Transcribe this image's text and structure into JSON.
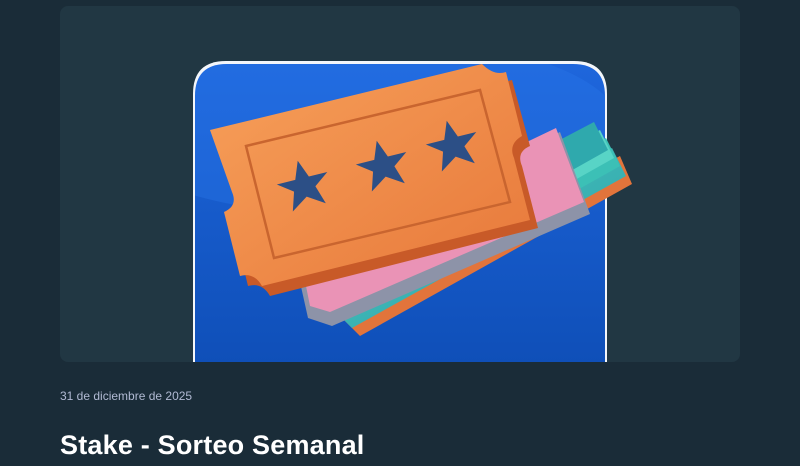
{
  "post": {
    "date": "31 de diciembre de 2025",
    "title": "Stake - Sorteo Semanal"
  },
  "hero": {
    "icon": "raffle-tickets-icon",
    "ticket_stars": 3
  },
  "colors": {
    "page_background": "#1a2c38",
    "card_background": "#213743",
    "title_text": "#ffffff",
    "date_text": "#b1bad3",
    "app_icon_blue": "#1f6fe0",
    "ticket_orange": "#f28a45",
    "ticket_teal": "#3bb7b2",
    "ticket_pink": "#e98fb3",
    "star_blue": "#2c4f86"
  }
}
